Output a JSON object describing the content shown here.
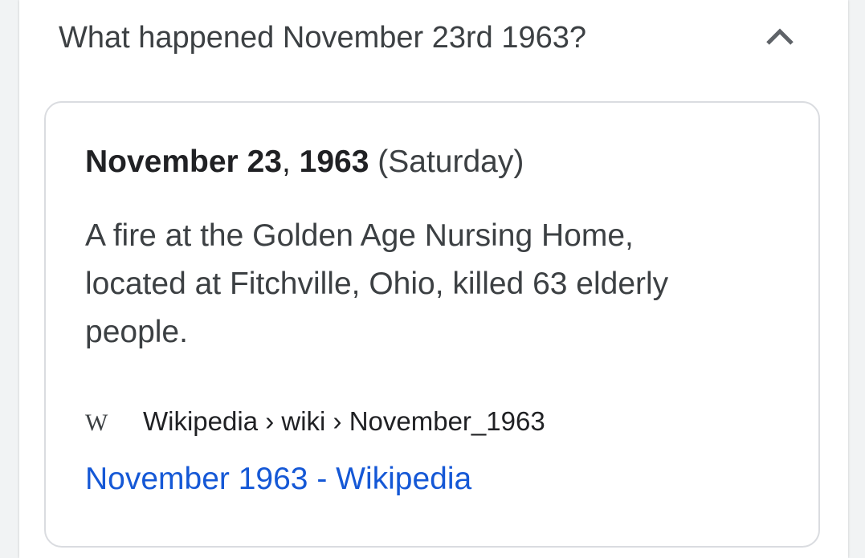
{
  "question": {
    "text": "What happened November 23rd 1963?",
    "toggle_icon": "chevron-up-icon"
  },
  "answer_card": {
    "date_bold_1": "November 23",
    "date_comma": ",",
    "date_bold_2": "1963",
    "date_day": "(Saturday)",
    "snippet_lines": [
      "A fire at the Golden Age Nursing Home,",
      "located at Fitchville, Ohio, killed 63 elderly",
      "people."
    ],
    "source": {
      "logo_icon": "wikipedia-logo-icon",
      "logo_text": "W",
      "breadcrumb": "Wikipedia › wiki › November_1963"
    },
    "result_title": "November 1963 - Wikipedia"
  },
  "colors": {
    "link": "#1558d6",
    "text": "#3c4043",
    "border": "#dadce0"
  }
}
